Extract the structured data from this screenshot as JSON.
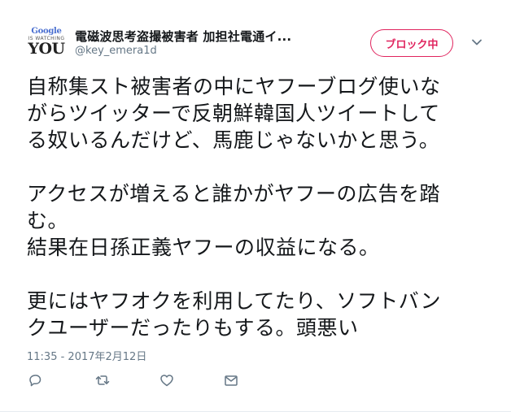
{
  "author": {
    "avatar_text": {
      "line1": "Google",
      "line2": "IS WATCHING",
      "line3": "YOU"
    },
    "display_name": "電磁波思考盗撮被害者 加担社電通イ...",
    "handle": "@key_emera1d"
  },
  "block_button": {
    "label": "ブロック中"
  },
  "tweet": {
    "lines": [
      "自称集スト被害者の中にヤフーブログ使いな",
      "がらツイッターで反朝鮮韓国人ツイートして",
      "る奴いるんだけど、馬鹿じゃないかと思う。",
      "",
      "アクセスが増えると誰かがヤフーの広告を踏",
      "む。",
      "結果在日孫正義ヤフーの収益になる。",
      "",
      "更にはヤフオクを利用してたり、ソフトバン",
      "クユーザーだったりもする。頭悪い"
    ],
    "timestamp": "11:35 - 2017年2月12日"
  },
  "icons": {
    "reply": "reply-icon",
    "retweet": "retweet-icon",
    "like": "heart-icon",
    "dm": "envelope-icon",
    "more": "chevron-down-icon"
  },
  "colors": {
    "block_accent": "#e0245e",
    "secondary_text": "#657786",
    "primary_text": "#14171a",
    "icon_gray": "#657786"
  }
}
